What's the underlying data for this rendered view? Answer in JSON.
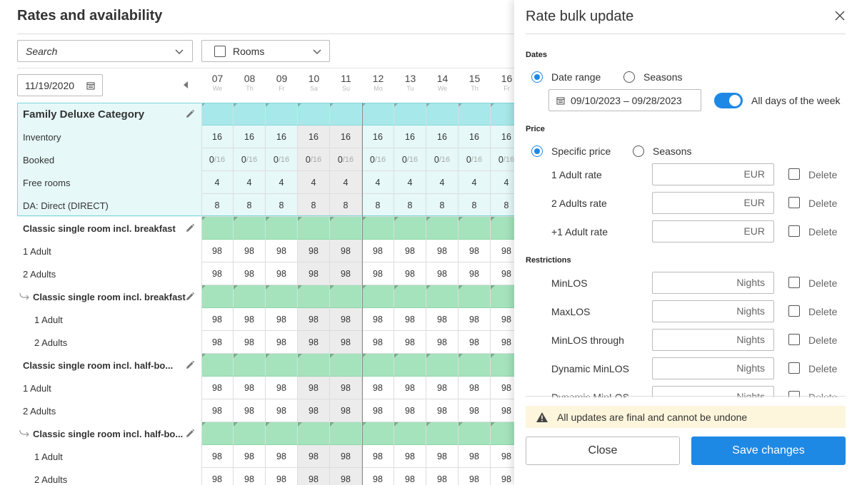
{
  "main": {
    "title": "Rates and availability",
    "search_placeholder": "Search",
    "rooms_label": "Rooms",
    "date_value": "11/19/2020",
    "days": [
      {
        "num": "07",
        "wd": "We"
      },
      {
        "num": "08",
        "wd": "Th"
      },
      {
        "num": "09",
        "wd": "Fr"
      },
      {
        "num": "10",
        "wd": "Sa"
      },
      {
        "num": "11",
        "wd": "Su"
      },
      {
        "num": "12",
        "wd": "Mo"
      },
      {
        "num": "13",
        "wd": "Tu"
      },
      {
        "num": "14",
        "wd": "We"
      },
      {
        "num": "15",
        "wd": "Th"
      },
      {
        "num": "16",
        "wd": "Fr"
      }
    ],
    "rows": [
      {
        "type": "category",
        "label": "Family Deluxe Category"
      },
      {
        "type": "data",
        "label": "Inventory",
        "value": "16",
        "teal": true
      },
      {
        "type": "booked",
        "label": "Booked",
        "value": "0",
        "total": "/16",
        "teal": true
      },
      {
        "type": "data",
        "label": "Free rooms",
        "value": "4",
        "teal": true
      },
      {
        "type": "data",
        "label": "DA: Direct (DIRECT)",
        "value": "8",
        "teal": true
      },
      {
        "type": "rate",
        "label": "Classic single room incl. breakfast"
      },
      {
        "type": "data",
        "label": "1 Adult",
        "value": "98"
      },
      {
        "type": "data",
        "label": "2 Adults",
        "value": "98"
      },
      {
        "type": "subrate",
        "label": "Classic single room incl. breakfast"
      },
      {
        "type": "data",
        "label": "1 Adult",
        "value": "98",
        "indent": true
      },
      {
        "type": "data",
        "label": "2 Adults",
        "value": "98",
        "indent": true
      },
      {
        "type": "rate",
        "label": "Classic single room incl. half-bo..."
      },
      {
        "type": "data",
        "label": "1 Adult",
        "value": "98"
      },
      {
        "type": "data",
        "label": "2 Adults",
        "value": "98"
      },
      {
        "type": "subrate",
        "label": "Classic single room incl. half-bo..."
      },
      {
        "type": "data",
        "label": "1 Adult",
        "value": "98",
        "indent": true
      },
      {
        "type": "data",
        "label": "2 Adults",
        "value": "98",
        "indent": true
      }
    ]
  },
  "panel": {
    "title": "Rate bulk update",
    "dates_heading": "Dates",
    "date_range_label": "Date range",
    "seasons_label": "Seasons",
    "date_range_value": "09/10/2023 – 09/28/2023",
    "all_days_label": "All days of the week",
    "price_heading": "Price",
    "specific_price_label": "Specific price",
    "price_seasons_label": "Seasons",
    "price_fields": [
      {
        "label": "1 Adult rate",
        "unit": "EUR",
        "delete": "Delete"
      },
      {
        "label": "2 Adults rate",
        "unit": "EUR",
        "delete": "Delete"
      },
      {
        "label": "+1 Adult rate",
        "unit": "EUR",
        "delete": "Delete"
      }
    ],
    "restrictions_heading": "Restrictions",
    "restriction_fields": [
      {
        "label": "MinLOS",
        "unit": "Nights",
        "delete": "Delete"
      },
      {
        "label": "MaxLOS",
        "unit": "Nights",
        "delete": "Delete"
      },
      {
        "label": "MinLOS through",
        "unit": "Nights",
        "delete": "Delete"
      },
      {
        "label": "Dynamic MinLOS",
        "unit": "Nights",
        "delete": "Delete"
      },
      {
        "label": "Dynamic MinLOS",
        "unit": "Nights",
        "delete": "Delete"
      }
    ],
    "warning_text": "All updates are final and cannot be undone",
    "close_label": "Close",
    "save_label": "Save changes"
  },
  "colors": {
    "accent": "#1e88e5",
    "category_header": "#a7e8ea",
    "rate_header": "#a5e3bd",
    "weekend_cell": "#ececec",
    "warning_bg": "#fdf6dc"
  },
  "icons": [
    "chevron-down-icon",
    "calendar-icon",
    "arrow-left-icon",
    "pencil-icon",
    "sub-arrow-icon",
    "close-icon",
    "warning-icon"
  ]
}
